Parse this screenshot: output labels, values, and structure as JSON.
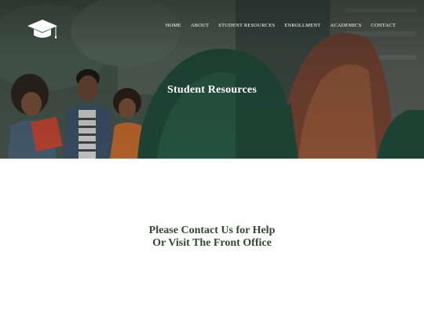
{
  "nav": {
    "items": [
      {
        "label": "HOME"
      },
      {
        "label": "ABOUT"
      },
      {
        "label": "STUDENT RESOURCES"
      },
      {
        "label": "ENROLLMENT"
      },
      {
        "label": "ACADEMICS"
      },
      {
        "label": "CONTACT"
      }
    ]
  },
  "logo": {
    "icon": "graduation-cap-icon"
  },
  "hero": {
    "title": "Student Resources"
  },
  "main": {
    "message_line1": "Please Contact Us for Help",
    "message_line2": "Or Visit The Front Office"
  },
  "colors": {
    "message_text": "#2f4a2c",
    "hero_text": "#ffffff",
    "jacket_green": "#1f4a3a"
  }
}
